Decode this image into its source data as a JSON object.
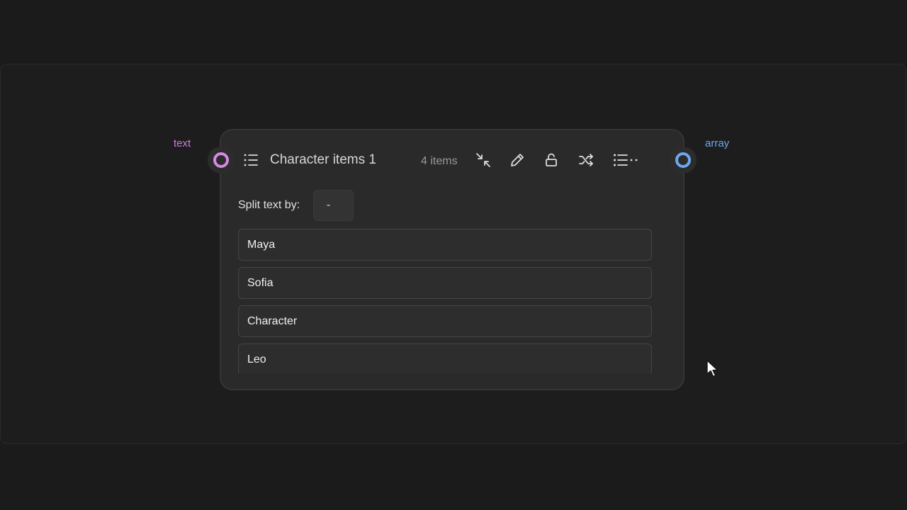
{
  "ports": {
    "input_label": "text",
    "output_label": "array",
    "input_color": "#d48ae2",
    "output_color": "#6ea8f0"
  },
  "node": {
    "title": "Character items 1",
    "count": "4 items",
    "icon": "list-icon",
    "tools": [
      {
        "name": "collapse-icon"
      },
      {
        "name": "pencil-icon"
      },
      {
        "name": "unlock-icon"
      },
      {
        "name": "shuffle-icon"
      },
      {
        "name": "list-options-icon"
      }
    ]
  },
  "split": {
    "label": "Split text by:",
    "value": "-"
  },
  "items": [
    {
      "value": "Maya"
    },
    {
      "value": "Sofia"
    },
    {
      "value": "Character"
    },
    {
      "value": "Leo"
    }
  ]
}
